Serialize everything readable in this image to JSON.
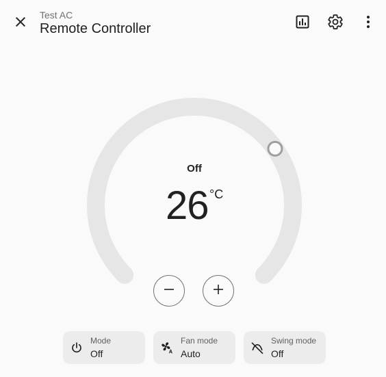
{
  "header": {
    "subtitle": "Test AC",
    "title": "Remote Controller",
    "icons": {
      "close": "close-icon",
      "history": "history-chart-icon",
      "settings": "gear-icon",
      "more": "more-vertical-icon"
    }
  },
  "dial": {
    "state": "Off",
    "temperature": "26",
    "unit": "°C",
    "colors": {
      "track": "#e6e6e6",
      "handle_border": "#9e9e9e"
    }
  },
  "features": [
    {
      "label": "Mode",
      "value": "Off",
      "icon": "power-icon"
    },
    {
      "label": "Fan mode",
      "value": "Auto",
      "icon": "fan-auto-icon"
    },
    {
      "label": "Swing mode",
      "value": "Off",
      "icon": "swing-off-icon"
    }
  ]
}
